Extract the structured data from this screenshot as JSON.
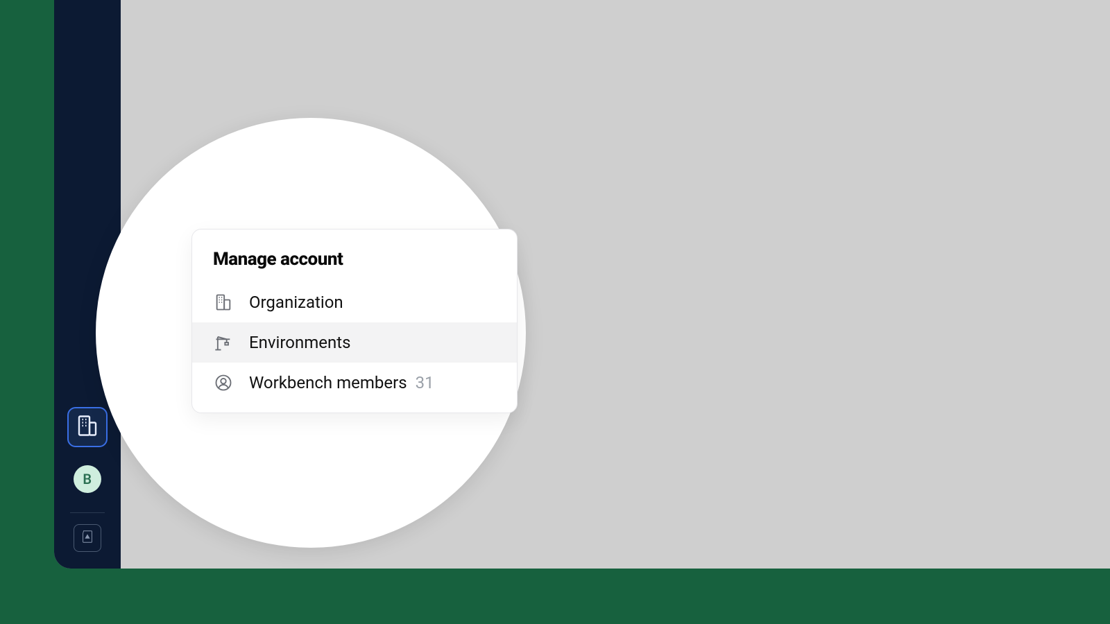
{
  "sidebar": {
    "avatar_initial": "B"
  },
  "popover": {
    "title": "Manage account",
    "items": [
      {
        "label": "Organization",
        "count": ""
      },
      {
        "label": "Environments",
        "count": ""
      },
      {
        "label": "Workbench members",
        "count": "31"
      }
    ]
  }
}
